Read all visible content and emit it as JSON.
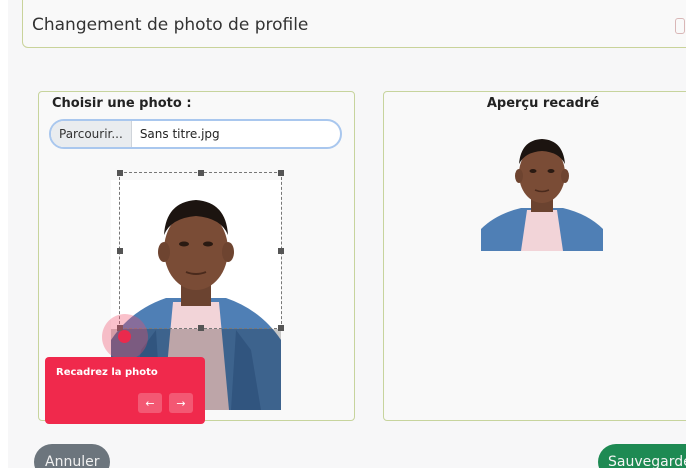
{
  "header": {
    "title": "Changement de photo de profile"
  },
  "left_card": {
    "label": "Choisir une photo :",
    "file_input": {
      "button_label": "Parcourir...",
      "file_name": "Sans titre.jpg"
    }
  },
  "right_card": {
    "label": "Aperçu recadré"
  },
  "tour": {
    "text": "Recadrez la photo",
    "prev_icon": "←",
    "next_icon": "→"
  },
  "footer": {
    "cancel_label": "Annuler",
    "save_label": "Sauvegarder"
  },
  "colors": {
    "accent_border": "#c7d49d",
    "tour_red": "#f0294c",
    "cancel_gray": "#6c757d",
    "save_green": "#1e8a53"
  }
}
